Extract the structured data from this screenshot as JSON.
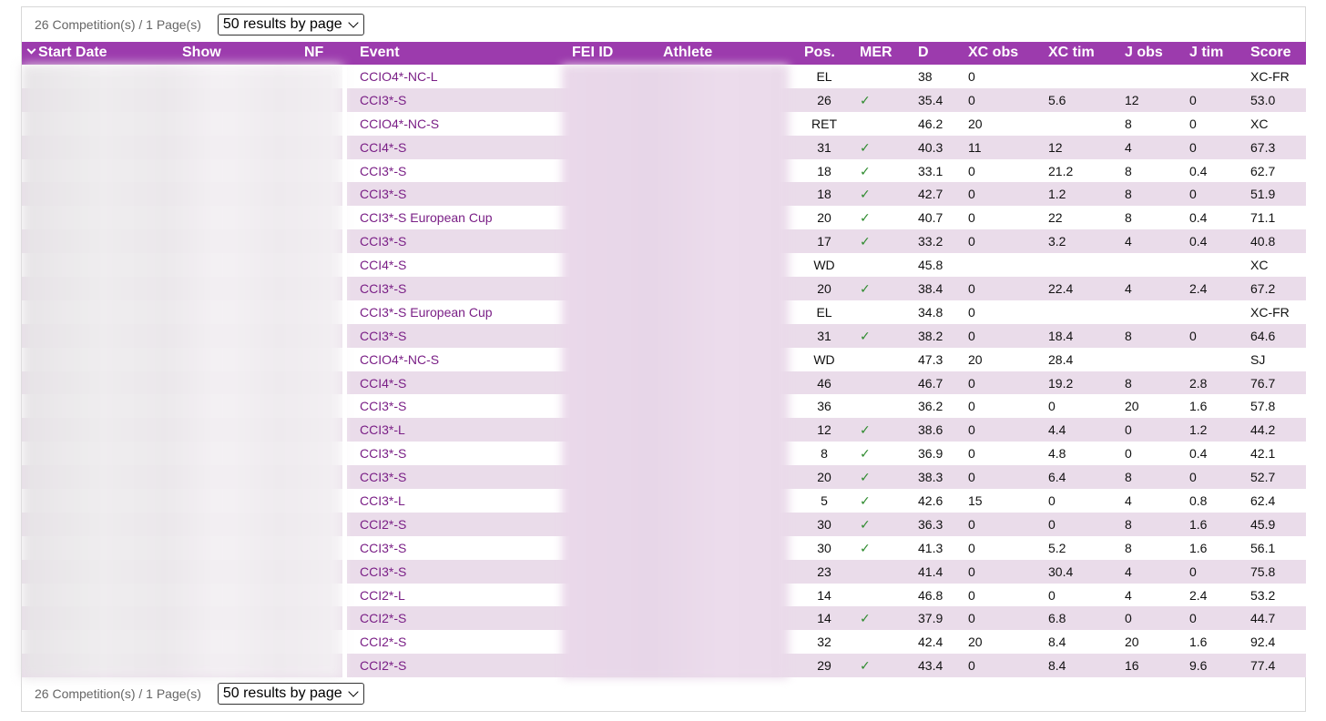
{
  "pager": {
    "summary": "26 Competition(s) / 1 Page(s)",
    "per_page": "50 results by page"
  },
  "columns": [
    "Start Date",
    "Show",
    "NF",
    "Event",
    "FEI ID",
    "Athlete",
    "Pos.",
    "MER",
    "D",
    "XC obs",
    "XC tim",
    "J obs",
    "J tim",
    "Score"
  ],
  "rows": [
    {
      "event": "CCIO4*-NC-L",
      "pos": "EL",
      "mer": "",
      "d": "38",
      "xco": "0",
      "xct": "",
      "jo": "",
      "jt": "",
      "sc": "XC-FR"
    },
    {
      "event": "CCI3*-S",
      "pos": "26",
      "mer": "✓",
      "d": "35.4",
      "xco": "0",
      "xct": "5.6",
      "jo": "12",
      "jt": "0",
      "sc": "53.0"
    },
    {
      "event": "CCIO4*-NC-S",
      "pos": "RET",
      "mer": "",
      "d": "46.2",
      "xco": "20",
      "xct": "",
      "jo": "8",
      "jt": "0",
      "sc": "XC"
    },
    {
      "event": "CCI4*-S",
      "pos": "31",
      "mer": "✓",
      "d": "40.3",
      "xco": "11",
      "xct": "12",
      "jo": "4",
      "jt": "0",
      "sc": "67.3"
    },
    {
      "event": "CCI3*-S",
      "pos": "18",
      "mer": "✓",
      "d": "33.1",
      "xco": "0",
      "xct": "21.2",
      "jo": "8",
      "jt": "0.4",
      "sc": "62.7"
    },
    {
      "event": "CCI3*-S",
      "pos": "18",
      "mer": "✓",
      "d": "42.7",
      "xco": "0",
      "xct": "1.2",
      "jo": "8",
      "jt": "0",
      "sc": "51.9"
    },
    {
      "event": "CCI3*-S European Cup",
      "pos": "20",
      "mer": "✓",
      "d": "40.7",
      "xco": "0",
      "xct": "22",
      "jo": "8",
      "jt": "0.4",
      "sc": "71.1"
    },
    {
      "event": "CCI3*-S",
      "pos": "17",
      "mer": "✓",
      "d": "33.2",
      "xco": "0",
      "xct": "3.2",
      "jo": "4",
      "jt": "0.4",
      "sc": "40.8"
    },
    {
      "event": "CCI4*-S",
      "pos": "WD",
      "mer": "",
      "d": "45.8",
      "xco": "",
      "xct": "",
      "jo": "",
      "jt": "",
      "sc": "XC"
    },
    {
      "event": "CCI3*-S",
      "pos": "20",
      "mer": "✓",
      "d": "38.4",
      "xco": "0",
      "xct": "22.4",
      "jo": "4",
      "jt": "2.4",
      "sc": "67.2"
    },
    {
      "event": "CCI3*-S European Cup",
      "pos": "EL",
      "mer": "",
      "d": "34.8",
      "xco": "0",
      "xct": "",
      "jo": "",
      "jt": "",
      "sc": "XC-FR"
    },
    {
      "event": "CCI3*-S",
      "pos": "31",
      "mer": "✓",
      "d": "38.2",
      "xco": "0",
      "xct": "18.4",
      "jo": "8",
      "jt": "0",
      "sc": "64.6"
    },
    {
      "event": "CCIO4*-NC-S",
      "pos": "WD",
      "mer": "",
      "d": "47.3",
      "xco": "20",
      "xct": "28.4",
      "jo": "",
      "jt": "",
      "sc": "SJ"
    },
    {
      "event": "CCI4*-S",
      "pos": "46",
      "mer": "",
      "d": "46.7",
      "xco": "0",
      "xct": "19.2",
      "jo": "8",
      "jt": "2.8",
      "sc": "76.7"
    },
    {
      "event": "CCI3*-S",
      "pos": "36",
      "mer": "",
      "d": "36.2",
      "xco": "0",
      "xct": "0",
      "jo": "20",
      "jt": "1.6",
      "sc": "57.8"
    },
    {
      "event": "CCI3*-L",
      "pos": "12",
      "mer": "✓",
      "d": "38.6",
      "xco": "0",
      "xct": "4.4",
      "jo": "0",
      "jt": "1.2",
      "sc": "44.2"
    },
    {
      "event": "CCI3*-S",
      "pos": "8",
      "mer": "✓",
      "d": "36.9",
      "xco": "0",
      "xct": "4.8",
      "jo": "0",
      "jt": "0.4",
      "sc": "42.1"
    },
    {
      "event": "CCI3*-S",
      "pos": "20",
      "mer": "✓",
      "d": "38.3",
      "xco": "0",
      "xct": "6.4",
      "jo": "8",
      "jt": "0",
      "sc": "52.7"
    },
    {
      "event": "CCI3*-L",
      "pos": "5",
      "mer": "✓",
      "d": "42.6",
      "xco": "15",
      "xct": "0",
      "jo": "4",
      "jt": "0.8",
      "sc": "62.4"
    },
    {
      "event": "CCI2*-S",
      "pos": "30",
      "mer": "✓",
      "d": "36.3",
      "xco": "0",
      "xct": "0",
      "jo": "8",
      "jt": "1.6",
      "sc": "45.9"
    },
    {
      "event": "CCI3*-S",
      "pos": "30",
      "mer": "✓",
      "d": "41.3",
      "xco": "0",
      "xct": "5.2",
      "jo": "8",
      "jt": "1.6",
      "sc": "56.1"
    },
    {
      "event": "CCI3*-S",
      "pos": "23",
      "mer": "",
      "d": "41.4",
      "xco": "0",
      "xct": "30.4",
      "jo": "4",
      "jt": "0",
      "sc": "75.8"
    },
    {
      "event": "CCI2*-L",
      "pos": "14",
      "mer": "",
      "d": "46.8",
      "xco": "0",
      "xct": "0",
      "jo": "4",
      "jt": "2.4",
      "sc": "53.2"
    },
    {
      "event": "CCI2*-S",
      "pos": "14",
      "mer": "✓",
      "d": "37.9",
      "xco": "0",
      "xct": "6.8",
      "jo": "0",
      "jt": "0",
      "sc": "44.7"
    },
    {
      "event": "CCI2*-S",
      "pos": "32",
      "mer": "",
      "d": "42.4",
      "xco": "20",
      "xct": "8.4",
      "jo": "20",
      "jt": "1.6",
      "sc": "92.4"
    },
    {
      "event": "CCI2*-S",
      "pos": "29",
      "mer": "✓",
      "d": "43.4",
      "xco": "0",
      "xct": "8.4",
      "jo": "16",
      "jt": "9.6",
      "sc": "77.4"
    }
  ],
  "colors": {
    "header_bg": "#9c3bad",
    "row_alt": "#eadcea",
    "link": "#7a1f86",
    "check": "#2e8b2e"
  }
}
